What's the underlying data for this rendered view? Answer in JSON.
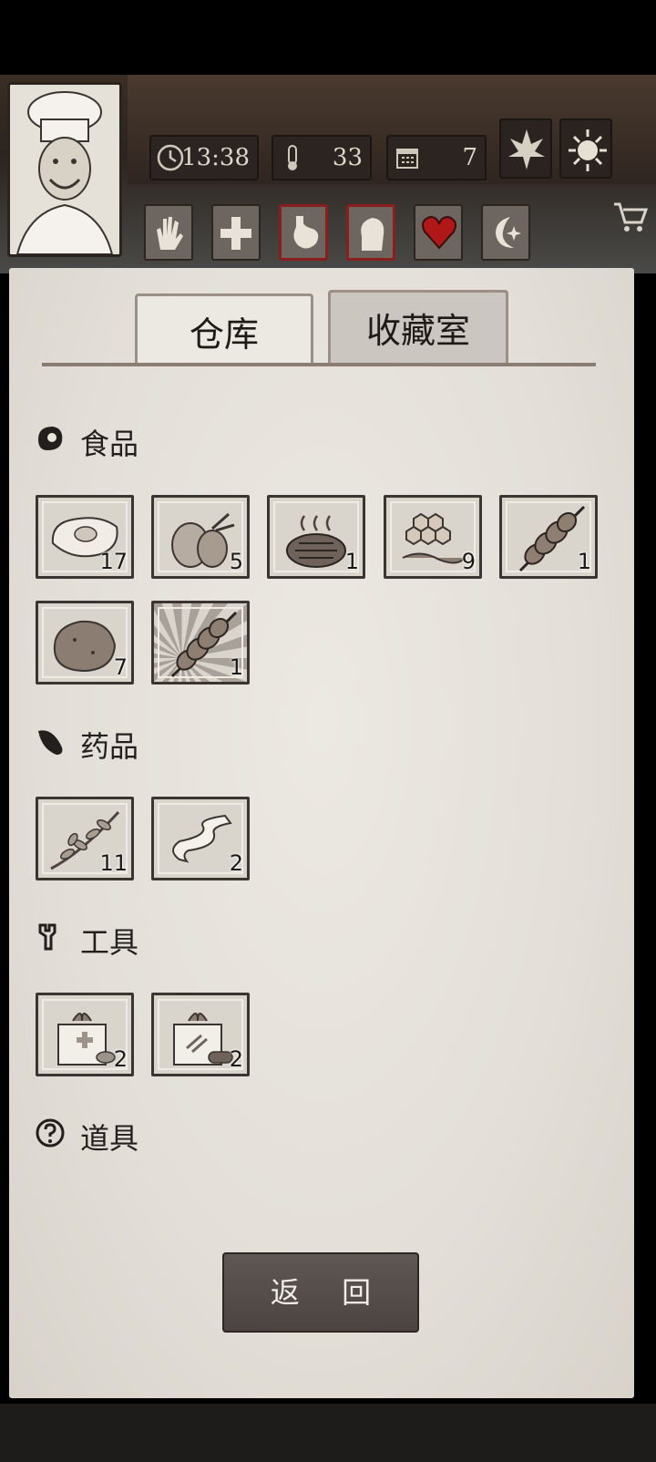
{
  "hud": {
    "time": "13:38",
    "temperature": "33",
    "day": "7",
    "season_icon": "leaf-icon",
    "weather_icon": "sun-icon",
    "conditions": [
      {
        "name": "hand-icon",
        "alert": false
      },
      {
        "name": "medical-cross-icon",
        "alert": false
      },
      {
        "name": "stomach-icon",
        "alert": true
      },
      {
        "name": "head-icon",
        "alert": true
      },
      {
        "name": "heart-icon",
        "alert": false
      },
      {
        "name": "moon-star-icon",
        "alert": false
      }
    ]
  },
  "tabs": {
    "storage": "仓库",
    "collection": "收藏室"
  },
  "sections": {
    "food": {
      "title": "食品",
      "items": [
        {
          "icon": "raw-meat-icon",
          "count": "17"
        },
        {
          "icon": "coconut-icon",
          "count": "5"
        },
        {
          "icon": "grilled-steak-icon",
          "count": "1"
        },
        {
          "icon": "honeycomb-icon",
          "count": "9"
        },
        {
          "icon": "meat-skewer-icon",
          "count": "1"
        },
        {
          "icon": "potato-icon",
          "count": "7"
        },
        {
          "icon": "meat-skewer-special-icon",
          "count": "1"
        }
      ]
    },
    "medicine": {
      "title": "药品",
      "items": [
        {
          "icon": "herb-icon",
          "count": "11"
        },
        {
          "icon": "bandage-icon",
          "count": "2"
        }
      ]
    },
    "tools": {
      "title": "工具",
      "items": [
        {
          "icon": "medkit-herb-box-icon",
          "count": "2"
        },
        {
          "icon": "supply-wood-box-icon",
          "count": "2"
        }
      ]
    },
    "props": {
      "title": "道具"
    }
  },
  "footer": {
    "back_label": "返 回"
  }
}
